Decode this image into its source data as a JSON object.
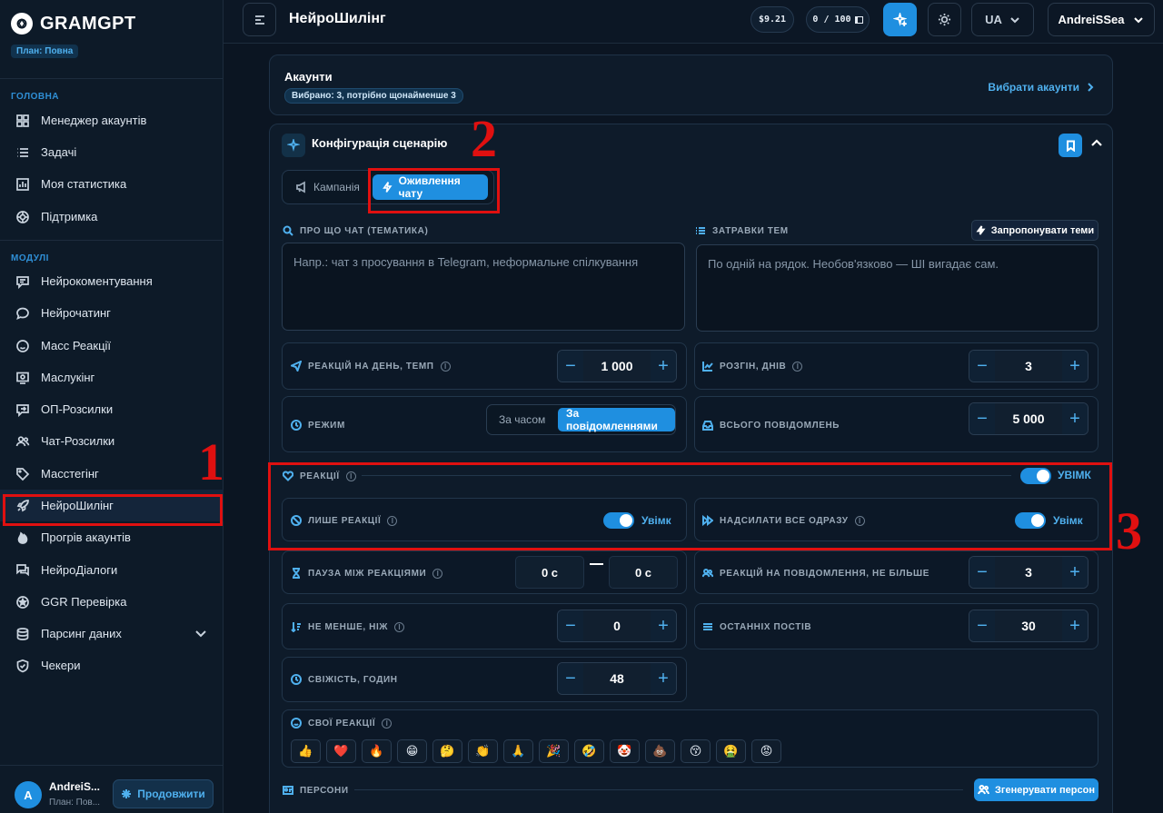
{
  "brand": {
    "name": "GRAMGPT",
    "plan": "План: Повна"
  },
  "sidebar": {
    "section_main": "ГОЛОВНА",
    "main_items": [
      {
        "label": "Менеджер акаунтів",
        "icon": "grid-icon"
      },
      {
        "label": "Задачі",
        "icon": "list-icon"
      },
      {
        "label": "Моя статистика",
        "icon": "bar-chart-icon"
      },
      {
        "label": "Підтримка",
        "icon": "lifebuoy-icon"
      }
    ],
    "section_modules": "МОДУЛІ",
    "module_items": [
      {
        "label": "Нейрокоментування",
        "icon": "comments-icon"
      },
      {
        "label": "Нейрочатинг",
        "icon": "chat-bubble-icon"
      },
      {
        "label": "Масс Реакції",
        "icon": "smile-icon"
      },
      {
        "label": "Маслукінг",
        "icon": "eye-screen-icon"
      },
      {
        "label": "ОП-Розсилки",
        "icon": "send-box-icon"
      },
      {
        "label": "Чат-Розсилки",
        "icon": "users-icon"
      },
      {
        "label": "Масстегінг",
        "icon": "tag-icon"
      },
      {
        "label": "НейроШилінг",
        "icon": "rocket-icon",
        "active": true
      },
      {
        "label": "Прогрів акаунтів",
        "icon": "flame-icon"
      },
      {
        "label": "НейроДіалоги",
        "icon": "dialog-icon"
      },
      {
        "label": "GGR Перевірка",
        "icon": "star-badge-icon"
      },
      {
        "label": "Парсинг даних",
        "icon": "database-icon"
      },
      {
        "label": "Чекери",
        "icon": "shield-check-icon"
      }
    ],
    "user": {
      "initial": "A",
      "name": "AndreiS...",
      "plan": "План: Пов...",
      "continue": "Продовжити"
    }
  },
  "topbar": {
    "title": "НейроШилінг",
    "balance": "$9.21",
    "quota": "0 / 100",
    "lang": "UA",
    "username": "AndreiSSea"
  },
  "accounts": {
    "title": "Акаунти",
    "badge": "Вибрано: 3, потрібно щонайменше 3",
    "link": "Вибрати акаунти"
  },
  "config": {
    "title": "Конфігурація сценарію",
    "tabs": [
      "Кампанія",
      "Оживлення чату"
    ],
    "topic_label": "ПРО ЩО ЧАТ (ТЕМАТИКА)",
    "topic_placeholder": "Напр.: чат з просування в Telegram, неформальне спілкування",
    "seeds_label": "ЗАТРАВКИ ТЕМ",
    "seeds_placeholder": "По одній на рядок. Необов'язково — ШІ вигадає сам.",
    "suggest_button": "Запропонувати теми",
    "reactions_per_day_label": "РЕАКЦІЙ НА ДЕНЬ, ТЕМП",
    "reactions_per_day": "1 000",
    "warmup_label": "РОЗГІН, ДНІВ",
    "warmup": "3",
    "mode_label": "РЕЖИМ",
    "mode_options": [
      "За часом",
      "За повідомленнями"
    ],
    "total_label": "ВСЬОГО ПОВІДОМЛЕНЬ",
    "total": "5 000",
    "reactions_section": "РЕАКЦІЇ",
    "reactions_toggle": "УВІМК",
    "only_reactions_label": "ЛИШЕ РЕАКЦІЇ",
    "only_reactions_toggle": "Увімк",
    "send_all_label": "НАДСИЛАТИ ВСЕ ОДРАЗУ",
    "send_all_toggle": "Увімк",
    "pause_label": "ПАУЗА МІЖ РЕАКЦІЯМИ",
    "pause_from": "0 с",
    "pause_to": "0 с",
    "per_message_label": "РЕАКЦІЙ НА ПОВІДОМЛЕННЯ, НЕ БІЛЬШЕ",
    "per_message": "3",
    "min_label": "НЕ МЕНШЕ, НІЖ",
    "min": "0",
    "last_posts_label": "ОСТАННІХ ПОСТІВ",
    "last_posts": "30",
    "freshness_label": "СВІЖІСТЬ, ГОДИН",
    "freshness": "48",
    "own_reactions_label": "СВОЇ РЕАКЦІЇ",
    "emojis": [
      "👍",
      "❤️",
      "🔥",
      "😁",
      "🤔",
      "👏",
      "🙏",
      "🎉",
      "🤣",
      "🤡",
      "💩",
      "😚",
      "🤮",
      "😡"
    ],
    "personas_label": "ПЕРСОНИ",
    "generate_button": "Згенерувати персон"
  },
  "annotations": [
    "1",
    "2",
    "3"
  ]
}
